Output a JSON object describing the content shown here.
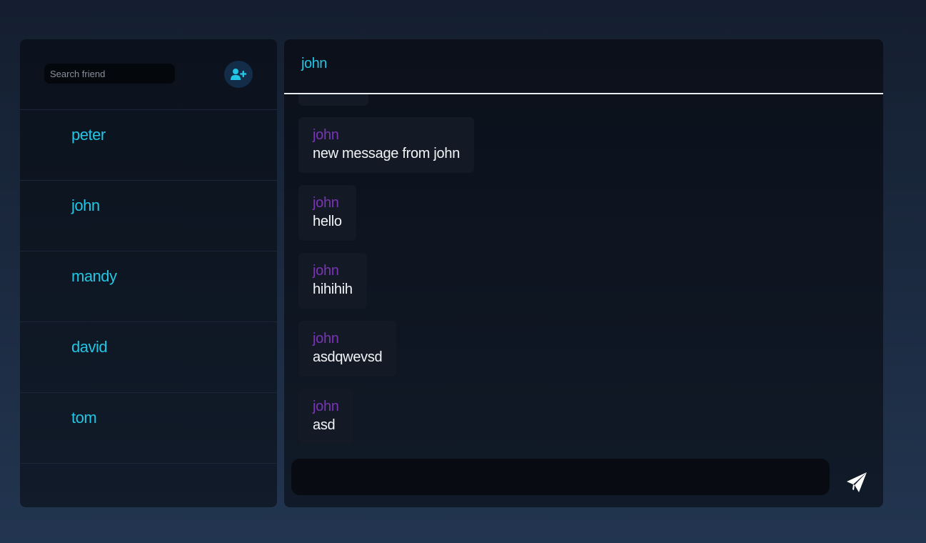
{
  "sidebar": {
    "search": {
      "placeholder": "Search friend",
      "value": ""
    },
    "add_friend_icon": "user-plus-icon",
    "friends": [
      "peter",
      "john",
      "mandy",
      "david",
      "tom"
    ]
  },
  "chat": {
    "title": "john",
    "messages": [
      {
        "sender": "john",
        "text": "new message from john"
      },
      {
        "sender": "john",
        "text": "hello"
      },
      {
        "sender": "john",
        "text": "hihihih"
      },
      {
        "sender": "john",
        "text": "asdqwevsd"
      },
      {
        "sender": "john",
        "text": "asd"
      }
    ],
    "composer": {
      "placeholder": "",
      "value": ""
    },
    "send_icon": "paper-plane-icon"
  },
  "colors": {
    "accent": "#22c5e3",
    "sender": "#7a35b5",
    "message_text": "#f2f4f7"
  }
}
